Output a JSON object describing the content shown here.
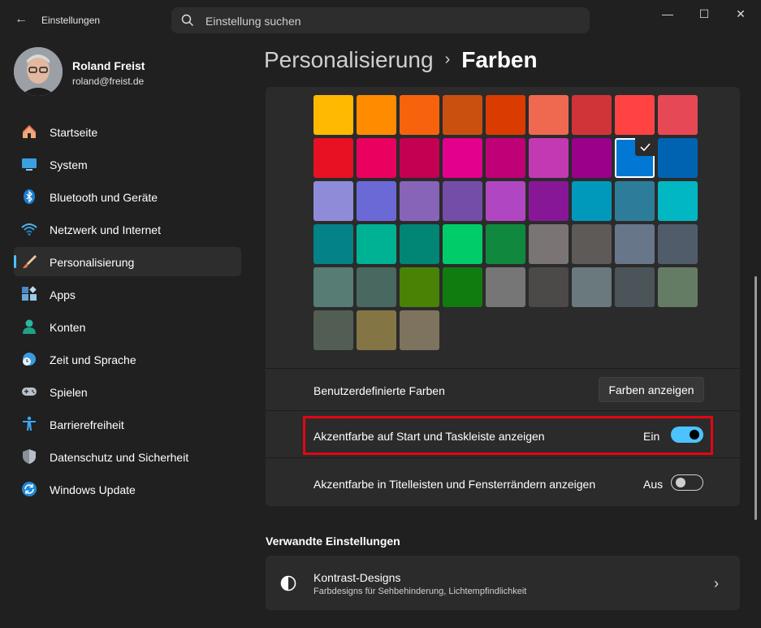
{
  "window": {
    "title": "Einstellungen",
    "back_glyph": "←",
    "minimize_glyph": "—",
    "maximize_glyph": "☐",
    "close_glyph": "✕"
  },
  "search": {
    "placeholder": "Einstellung suchen",
    "icon": "search-icon"
  },
  "profile": {
    "name": "Roland Freist",
    "email": "roland@freist.de"
  },
  "sidebar": {
    "items": [
      {
        "label": "Startseite",
        "icon": "home-icon"
      },
      {
        "label": "System",
        "icon": "monitor-icon"
      },
      {
        "label": "Bluetooth und Geräte",
        "icon": "bluetooth-icon"
      },
      {
        "label": "Netzwerk und Internet",
        "icon": "wifi-icon"
      },
      {
        "label": "Personalisierung",
        "icon": "brush-icon",
        "active": true
      },
      {
        "label": "Apps",
        "icon": "apps-icon"
      },
      {
        "label": "Konten",
        "icon": "person-icon"
      },
      {
        "label": "Zeit und Sprache",
        "icon": "globe-clock-icon"
      },
      {
        "label": "Spielen",
        "icon": "gamepad-icon"
      },
      {
        "label": "Barrierefreiheit",
        "icon": "accessibility-icon"
      },
      {
        "label": "Datenschutz und Sicherheit",
        "icon": "shield-icon"
      },
      {
        "label": "Windows Update",
        "icon": "update-icon"
      }
    ]
  },
  "breadcrumb": {
    "parent": "Personalisierung",
    "separator": "›",
    "current": "Farben"
  },
  "accent_colors": {
    "swatches": [
      "#FFB900",
      "#FF8C00",
      "#F7630C",
      "#CA5010",
      "#DA3B01",
      "#EF6950",
      "#D13438",
      "#FF4343",
      "#E74856",
      "#E81123",
      "#EA005E",
      "#C30052",
      "#E3008C",
      "#BF0077",
      "#C239B3",
      "#9A0089",
      "#0078D4",
      "#0063B1",
      "#8E8CD8",
      "#6B69D6",
      "#8764B8",
      "#744DA9",
      "#B146C2",
      "#881798",
      "#0099BC",
      "#2D7D9A",
      "#00B7C3",
      "#038387",
      "#00B294",
      "#018574",
      "#00CC6A",
      "#10893E",
      "#7A7574",
      "#5D5A58",
      "#68768A",
      "#515C6B",
      "#567C73",
      "#486860",
      "#498205",
      "#107C10",
      "#767676",
      "#4C4A48",
      "#69797E",
      "#4A5459",
      "#647C64",
      "#525E54",
      "#847545",
      "#7E735F"
    ],
    "selected_index": 16
  },
  "custom_colors": {
    "label": "Benutzerdefinierte Farben",
    "button_label": "Farben anzeigen"
  },
  "toggle_start_taskbar": {
    "label": "Akzentfarbe auf Start und Taskleiste anzeigen",
    "state": "Ein",
    "on": true
  },
  "toggle_titlebars": {
    "label": "Akzentfarbe in Titelleisten und Fensterrändern anzeigen",
    "state": "Aus",
    "on": false
  },
  "related": {
    "title": "Verwandte Einstellungen",
    "contrast": {
      "title": "Kontrast-Designs",
      "subtitle": "Farbdesigns für Sehbehinderung, Lichtempfindlichkeit",
      "chevron": "›"
    }
  },
  "colors": {
    "accent": "#4CC2FF",
    "highlight_frame": "#E30613",
    "background": "#202020",
    "card": "#2B2B2B"
  }
}
